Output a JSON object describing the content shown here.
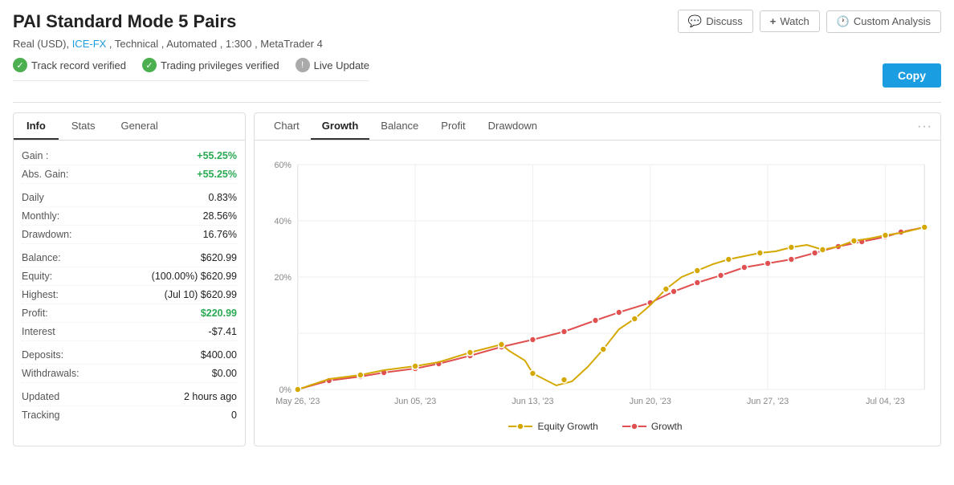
{
  "header": {
    "title": "PAI Standard Mode 5 Pairs",
    "subtitle": "Real (USD), ICE-FX , Technical , Automated , 1:300 , MetaTrader 4",
    "subtitle_link": "ICE-FX"
  },
  "actions": {
    "discuss_label": "Discuss",
    "watch_label": "Watch",
    "custom_analysis_label": "Custom Analysis",
    "copy_label": "Copy"
  },
  "badges": [
    {
      "type": "check",
      "label": "Track record verified"
    },
    {
      "type": "check",
      "label": "Trading privileges verified"
    },
    {
      "type": "warn",
      "label": "Live Update"
    }
  ],
  "left_tabs": [
    "Info",
    "Stats",
    "General"
  ],
  "active_left_tab": "Info",
  "info": {
    "gain_label": "Gain :",
    "gain_value": "+55.25%",
    "abs_gain_label": "Abs. Gain:",
    "abs_gain_value": "+55.25%",
    "daily_label": "Daily",
    "daily_value": "0.83%",
    "monthly_label": "Monthly:",
    "monthly_value": "28.56%",
    "drawdown_label": "Drawdown:",
    "drawdown_value": "16.76%",
    "balance_label": "Balance:",
    "balance_value": "$620.99",
    "equity_label": "Equity:",
    "equity_value": "(100.00%) $620.99",
    "highest_label": "Highest:",
    "highest_value": "(Jul 10) $620.99",
    "profit_label": "Profit:",
    "profit_value": "$220.99",
    "interest_label": "Interest",
    "interest_value": "-$7.41",
    "deposits_label": "Deposits:",
    "deposits_value": "$400.00",
    "withdrawals_label": "Withdrawals:",
    "withdrawals_value": "$0.00",
    "updated_label": "Updated",
    "updated_value": "2 hours ago",
    "tracking_label": "Tracking",
    "tracking_value": "0"
  },
  "chart_tabs": [
    "Chart",
    "Growth",
    "Balance",
    "Profit",
    "Drawdown"
  ],
  "active_chart_tab": "Growth",
  "chart": {
    "y_labels": [
      "0%",
      "20%",
      "40%",
      "60%"
    ],
    "x_labels": [
      "May 26, '23",
      "Jun 05, '23",
      "Jun 13, '23",
      "Jun 20, '23",
      "Jun 27, '23",
      "Jul 04, '23"
    ],
    "legend": [
      {
        "label": "Equity Growth",
        "color": "#e6c200",
        "type": "yellow"
      },
      {
        "label": "Growth",
        "color": "#e05050",
        "type": "red"
      }
    ]
  },
  "colors": {
    "accent": "#1a9de1",
    "green": "#2aaa53",
    "red": "#e05050",
    "yellow": "#e6b800"
  }
}
